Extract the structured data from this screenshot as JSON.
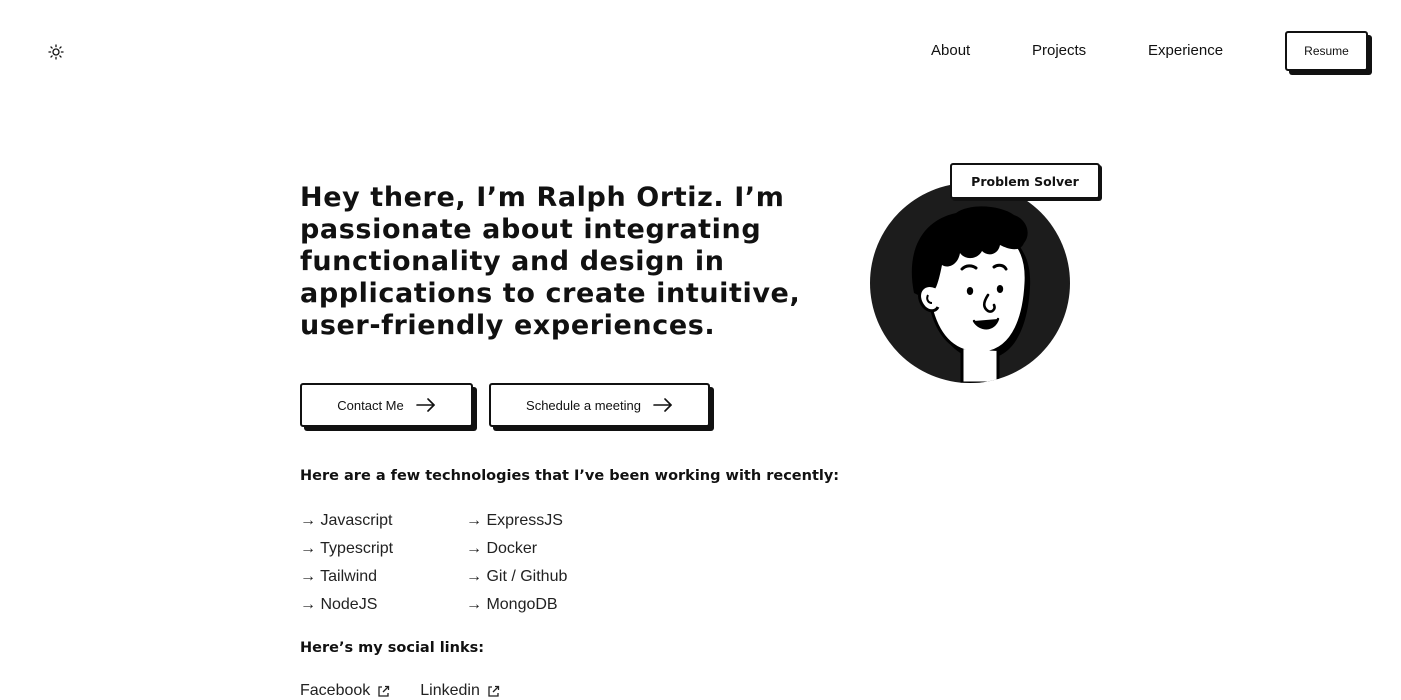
{
  "header": {
    "theme_icon": "sun-icon",
    "nav": [
      {
        "label": "About"
      },
      {
        "label": "Projects"
      },
      {
        "label": "Experience"
      }
    ],
    "resume_label": "Resume"
  },
  "hero": {
    "headline": "Hey there, I’m Ralph Ortiz. I’m passionate about integrating functionality and design in applications to create intuitive, user-friendly experiences.",
    "contact_label": "Contact Me",
    "meeting_label": "Schedule a meeting",
    "badge": "Problem Solver",
    "avatar_icon": "cartoon-avatar"
  },
  "technologies": {
    "heading": "Here are a few technologies that I’ve been working with recently:",
    "column_1": [
      "→ Javascript",
      "→ Typescript",
      "→ Tailwind",
      "→ NodeJS"
    ],
    "column_2": [
      "→ ExpressJS",
      "→ Docker",
      "→ Git / Github",
      "→ MongoDB"
    ]
  },
  "social": {
    "heading": "Here’s my social links:",
    "links": [
      {
        "label": "Facebook",
        "icon": "external-link-icon"
      },
      {
        "label": "Linkedin",
        "icon": "external-link-icon"
      }
    ]
  },
  "colors": {
    "text": "#111111",
    "background": "#ffffff",
    "avatar_bg": "#1c1c1c"
  }
}
